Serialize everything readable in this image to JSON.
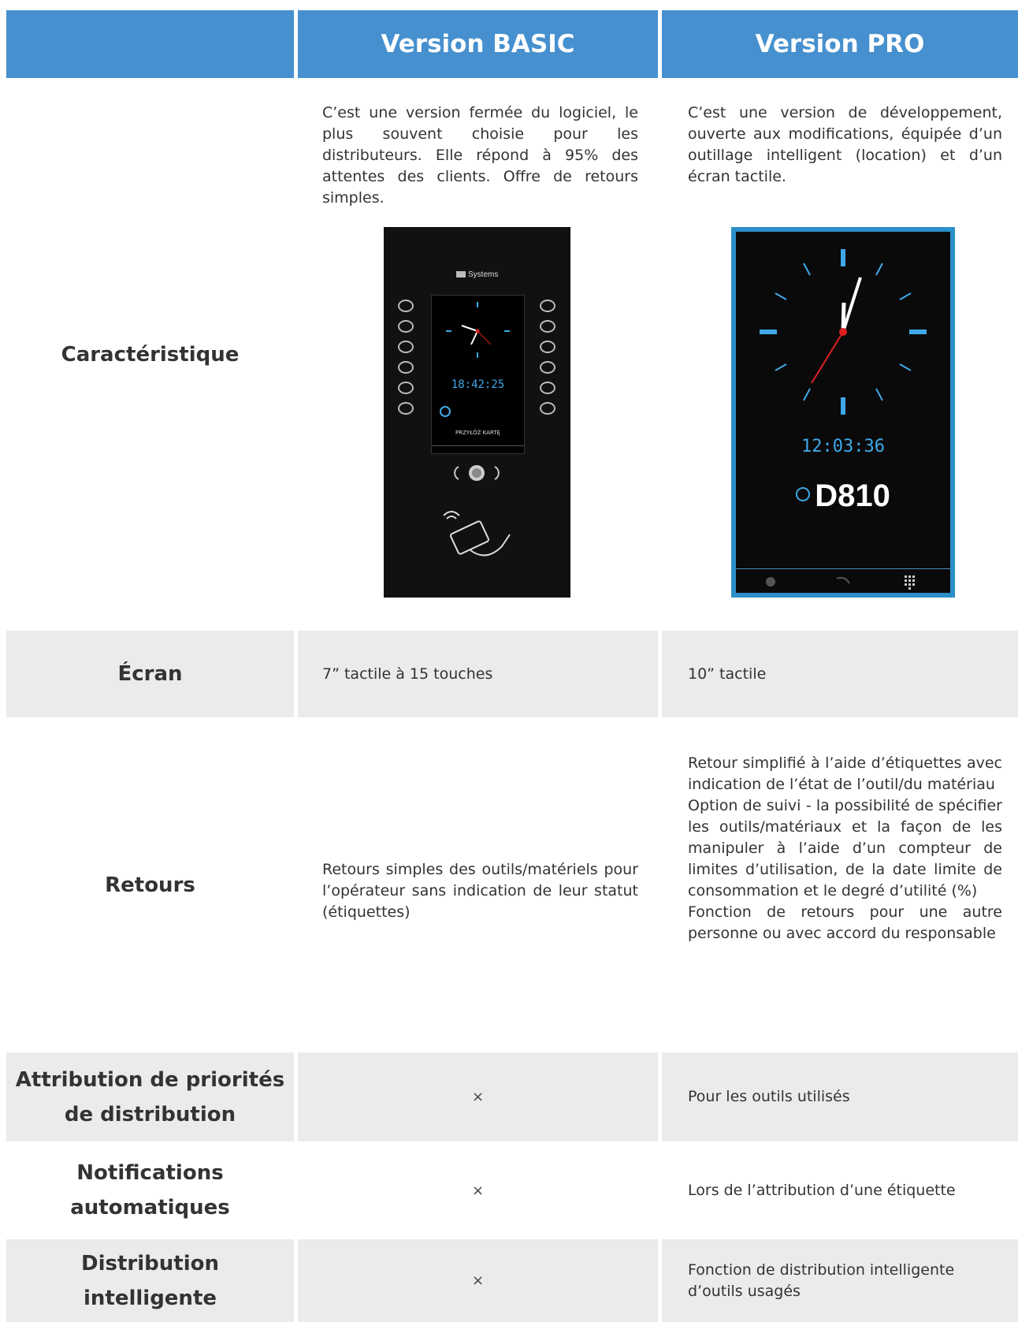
{
  "header": {
    "basic_title": "Version BASIC",
    "pro_title": "Version PRO"
  },
  "rows": {
    "caracteristique": {
      "label": "Caractéristique",
      "basic": "C’est une version fermée du logiciel, le plus souvent choisie pour les distributeurs. Elle répond à 95% des attentes des clients. Offre de retours simples.",
      "pro": "C’est une version de développement, ouverte aux modifications, équipée d’un outillage intelligent (location) et d’un écran tactile."
    },
    "ecran": {
      "label": "Écran",
      "basic": "7” tactile à 15 touches",
      "pro": "10” tactile"
    },
    "retours": {
      "label": "Retours",
      "basic": "Retours simples des outils/matériels pour l’opérateur sans indication de leur statut (étiquettes)",
      "pro_1": "Retour simplifié à l’aide d’étiquettes avec indication de l’état de l’outil/du matériau",
      "pro_2": "Option de suivi - la possibilité de spécifier les outils/matériaux et la façon de les manipuler à l’aide d’un compteur de limites d’utilisation, de la date limite de consommation et le degré d’utilité (%)",
      "pro_3": "Fonction de retours pour une autre personne ou avec accord du responsable"
    },
    "attribution": {
      "label": "Attribution de priorités de distribution",
      "basic": "×",
      "pro": "Pour les outils utilisés"
    },
    "notifications": {
      "label": "Notifications automatiques",
      "basic": "×",
      "pro": "Lors de l’attribution d’une étiquette"
    },
    "distribution": {
      "label": "Distribution intelligente",
      "basic": "×",
      "pro": "Fonction de distribution intelligente d’outils usagés"
    }
  },
  "devices": {
    "basic": {
      "logo": "Systems",
      "time": "18:42:25",
      "prompt": "PRZYŁÓŻ KARTĘ"
    },
    "pro": {
      "time": "12:03:36",
      "code": "D810"
    }
  },
  "colors": {
    "header_bg": "#4690cf",
    "row_gray": "#ebebeb",
    "accent_blue": "#3fa9e8"
  }
}
